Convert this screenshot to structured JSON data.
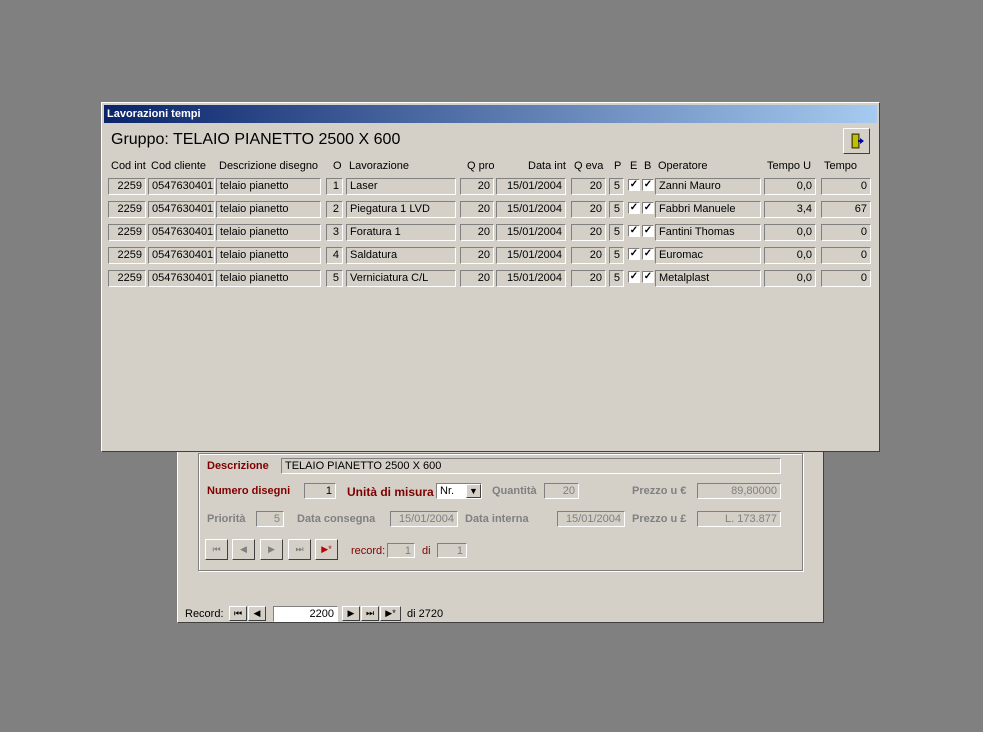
{
  "popup": {
    "title": "Lavorazioni tempi",
    "gruppo_label": "Gruppo:",
    "gruppo_value": "TELAIO PIANETTO 2500 X 600",
    "exit_icon": "exit-door-icon",
    "columns": [
      "Cod int",
      "Cod cliente",
      "Descrizione disegno",
      "O",
      "Lavorazione",
      "Q pro",
      "Data int",
      "Q eva",
      "P",
      "E",
      "B",
      "Operatore",
      "Tempo U",
      "Tempo"
    ],
    "rows": [
      {
        "cod_int": "2259",
        "cod_cliente": "0547630401",
        "descrizione": "telaio pianetto",
        "o": "1",
        "lavorazione": "Laser",
        "q_pro": "20",
        "data_int": "15/01/2004",
        "q_eva": "20",
        "p": "5",
        "e": "✓",
        "b": "✓",
        "operatore": "Zanni Mauro",
        "tempo_u": "0,0",
        "tempo": "0"
      },
      {
        "cod_int": "2259",
        "cod_cliente": "0547630401",
        "descrizione": "telaio pianetto",
        "o": "2",
        "lavorazione": "Piegatura 1 LVD",
        "q_pro": "20",
        "data_int": "15/01/2004",
        "q_eva": "20",
        "p": "5",
        "e": "✓",
        "b": "✓",
        "operatore": "Fabbri Manuele",
        "tempo_u": "3,4",
        "tempo": "67"
      },
      {
        "cod_int": "2259",
        "cod_cliente": "0547630401",
        "descrizione": "telaio pianetto",
        "o": "3",
        "lavorazione": "Foratura 1",
        "q_pro": "20",
        "data_int": "15/01/2004",
        "q_eva": "20",
        "p": "5",
        "e": "✓",
        "b": "✓",
        "operatore": "Fantini Thomas",
        "tempo_u": "0,0",
        "tempo": "0"
      },
      {
        "cod_int": "2259",
        "cod_cliente": "0547630401",
        "descrizione": "telaio pianetto",
        "o": "4",
        "lavorazione": "Saldatura",
        "q_pro": "20",
        "data_int": "15/01/2004",
        "q_eva": "20",
        "p": "5",
        "e": "✓",
        "b": "✓",
        "operatore": "Euromac",
        "tempo_u": "0,0",
        "tempo": "0"
      },
      {
        "cod_int": "2259",
        "cod_cliente": "0547630401",
        "descrizione": "telaio pianetto",
        "o": "5",
        "lavorazione": "Verniciatura C/L",
        "q_pro": "20",
        "data_int": "15/01/2004",
        "q_eva": "20",
        "p": "5",
        "e": "✓",
        "b": "✓",
        "operatore": "Metalplast",
        "tempo_u": "0,0",
        "tempo": "0"
      }
    ]
  },
  "form": {
    "descrizione_label": "Descrizione",
    "descrizione_value": "TELAIO PIANETTO 2500 X 600",
    "numero_disegni_label": "Numero disegni",
    "numero_disegni_value": "1",
    "unita_label": "Unità di misura",
    "unita_value": "Nr.",
    "quantita_label": "Quantità",
    "quantita_value": "20",
    "prezzo_eur_label": "Prezzo u €",
    "prezzo_eur_value": "89,80000",
    "priorita_label": "Priorità",
    "priorita_value": "5",
    "data_consegna_label": "Data consegna",
    "data_consegna_value": "15/01/2004",
    "data_interna_label": "Data interna",
    "data_interna_value": "15/01/2004",
    "prezzo_lire_label": "Prezzo u £",
    "prezzo_lire_value": "L. 173.877",
    "nav_record_label": "record:",
    "nav_record_value": "1",
    "nav_di_label": "di",
    "nav_di_value": "1"
  },
  "recordbar": {
    "label": "Record:",
    "value": "2200",
    "of_label": "di 2720"
  },
  "icons": {
    "first": "⏮",
    "prev": "◀",
    "next": "▶",
    "last": "⏭",
    "new": "▶*"
  }
}
